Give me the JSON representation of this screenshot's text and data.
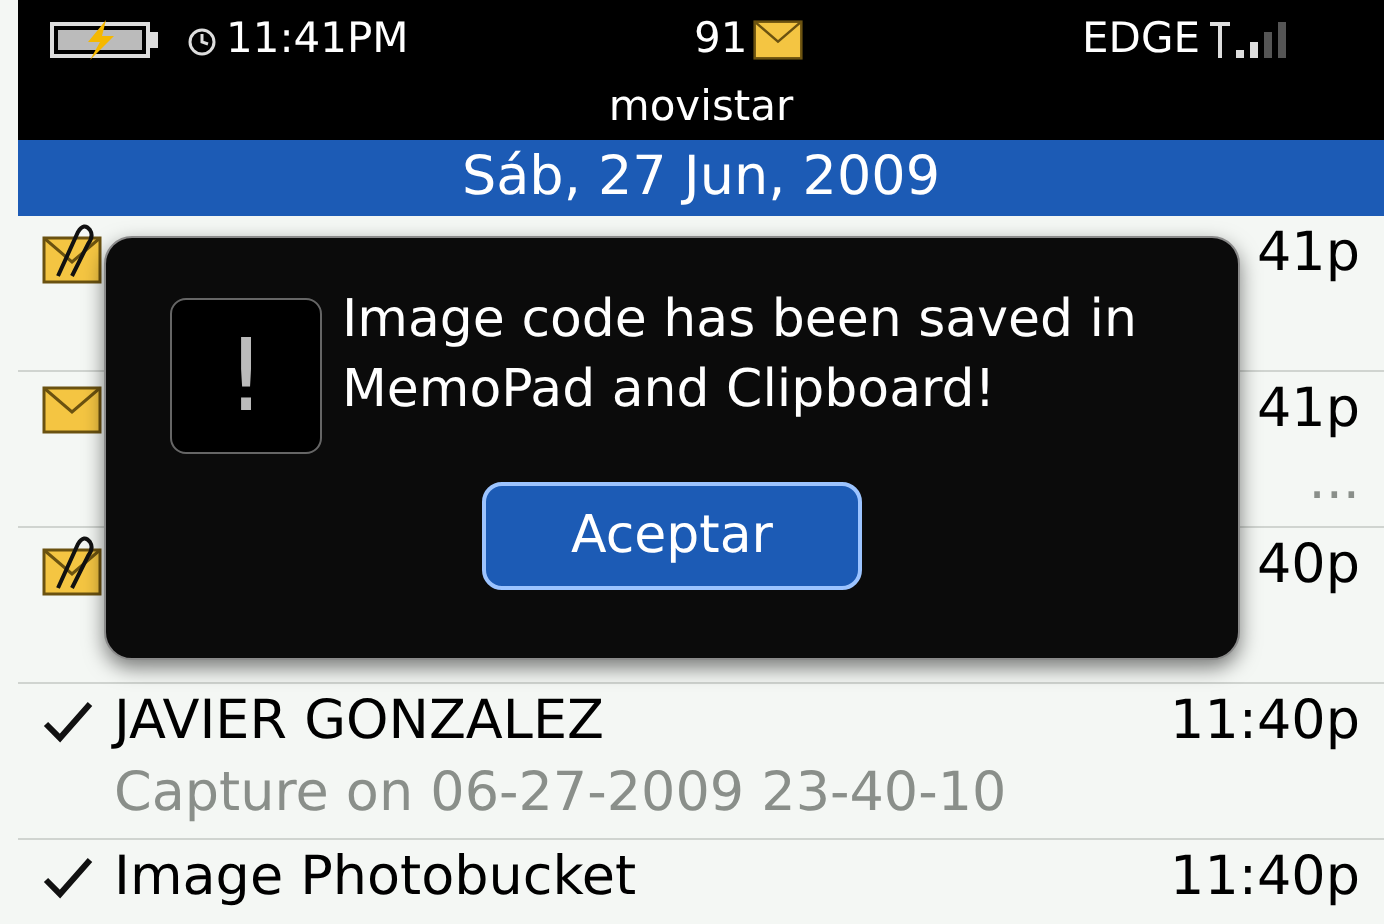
{
  "status_bar": {
    "time": "11:41PM",
    "message_count": "91",
    "network": "EDGE",
    "carrier": "movistar"
  },
  "date_header": "Sáb, 27 Jun, 2009",
  "messages": [
    {
      "kind": "attachment",
      "time": "41p"
    },
    {
      "kind": "unread",
      "time": "41p",
      "subtitle": "..."
    },
    {
      "kind": "attachment",
      "time": "40p"
    },
    {
      "kind": "sent",
      "name": "JAVIER GONZALEZ",
      "time": "11:40p",
      "subtitle": "Capture on 06-27-2009 23-40-10"
    },
    {
      "kind": "sent",
      "name": "Image Photobucket",
      "time": "11:40p"
    }
  ],
  "dialog": {
    "message": "Image code has been saved in MemoPad and Clipboard!",
    "icon_glyph": "!",
    "button": "Aceptar"
  }
}
